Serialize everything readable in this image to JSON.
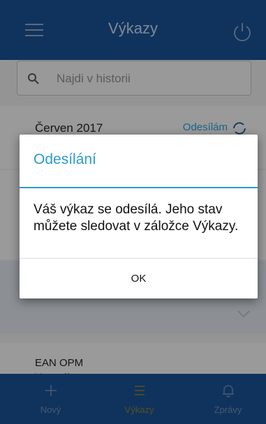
{
  "header": {
    "title": "Výkazy",
    "menu_icon": "hamburger-menu-icon",
    "power_icon": "power-icon"
  },
  "search": {
    "placeholder": "Najdi v historii",
    "icon": "search-icon"
  },
  "list": {
    "items": [
      {
        "title": "Červen 2017",
        "status": "Odesílám",
        "status_icon": "sync-icon"
      },
      {
        "title": "EAN OPM",
        "subtitle": "Vzor výkazu"
      }
    ]
  },
  "dialog": {
    "title": "Odesílání",
    "message": "Váš výkaz se odesílá. Jeho stav můžete sledovat v záložce Výkazy.",
    "ok_label": "OK"
  },
  "bottom_nav": {
    "items": [
      {
        "label": "Nový",
        "icon": "plus-icon",
        "active": false
      },
      {
        "label": "Výkazy",
        "icon": "list-icon",
        "active": true
      },
      {
        "label": "Zprávy",
        "icon": "bell-icon",
        "active": false
      }
    ]
  },
  "colors": {
    "primary": "#1a4f91",
    "accent": "#2a9bcf",
    "nav_active": "#8a7a2a",
    "nav_inactive": "#6f86a8"
  }
}
